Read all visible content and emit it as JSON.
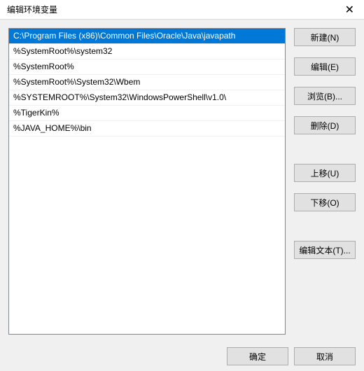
{
  "title": "编辑环境变量",
  "path_entries": [
    "C:\\Program Files (x86)\\Common Files\\Oracle\\Java\\javapath",
    "%SystemRoot%\\system32",
    "%SystemRoot%",
    "%SystemRoot%\\System32\\Wbem",
    "%SYSTEMROOT%\\System32\\WindowsPowerShell\\v1.0\\",
    "%TigerKin%",
    "%JAVA_HOME%\\bin"
  ],
  "selected_index": 0,
  "buttons": {
    "new": "新建(N)",
    "edit": "编辑(E)",
    "browse": "浏览(B)...",
    "delete": "删除(D)",
    "move_up": "上移(U)",
    "move_down": "下移(O)",
    "edit_text": "编辑文本(T)...",
    "ok": "确定",
    "cancel": "取消"
  }
}
